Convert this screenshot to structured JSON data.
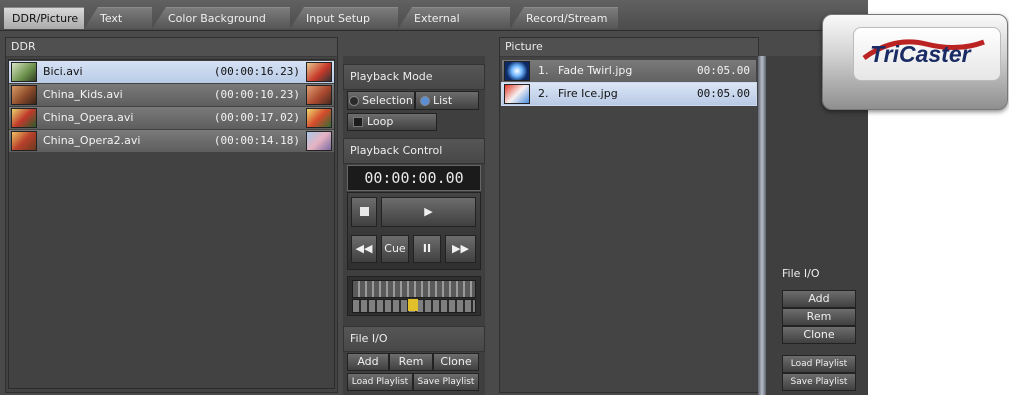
{
  "tabs": [
    {
      "label": "DDR/Picture",
      "active": true
    },
    {
      "label": "Text"
    },
    {
      "label": "Color Background"
    },
    {
      "label": "Input Setup"
    },
    {
      "label": "External"
    },
    {
      "label": "Record/Stream"
    }
  ],
  "ddr": {
    "title": "DDR",
    "items": [
      {
        "name": "Bici.avi",
        "duration": "(00:00:16.23)",
        "selected": true
      },
      {
        "name": "China_Kids.avi",
        "duration": "(00:00:10.23)"
      },
      {
        "name": "China_Opera.avi",
        "duration": "(00:00:17.02)"
      },
      {
        "name": "China_Opera2.avi",
        "duration": "(00:00:14.18)"
      }
    ]
  },
  "playback_mode": {
    "title": "Playback Mode",
    "selection_label": "Selection",
    "list_label": "List",
    "selected": "List",
    "loop_label": "Loop"
  },
  "playback_control": {
    "title": "Playback Control",
    "timecode": "00:00:00.00",
    "stop_icon": "stop-icon",
    "play_icon": "play-icon",
    "rewind_icon": "rewind-icon",
    "cue_label": "Cue",
    "pause_icon": "pause-icon",
    "fast_forward_icon": "fast-forward-icon"
  },
  "ddr_file_io": {
    "title": "File I/O",
    "add_label": "Add",
    "rem_label": "Rem",
    "clone_label": "Clone",
    "load_label": "Load Playlist",
    "save_label": "Save Playlist"
  },
  "picture": {
    "title": "Picture",
    "items": [
      {
        "num": "1.",
        "name": "Fade Twirl.jpg",
        "duration": "00:05.00"
      },
      {
        "num": "2.",
        "name": "Fire Ice.jpg",
        "duration": "00:05.00",
        "selected": true
      }
    ]
  },
  "picture_file_io": {
    "title": "File I/O",
    "add_label": "Add",
    "rem_label": "Rem",
    "clone_label": "Clone",
    "load_label": "Load Playlist",
    "save_label": "Save Playlist"
  },
  "logo": {
    "text": "TriCaster"
  }
}
